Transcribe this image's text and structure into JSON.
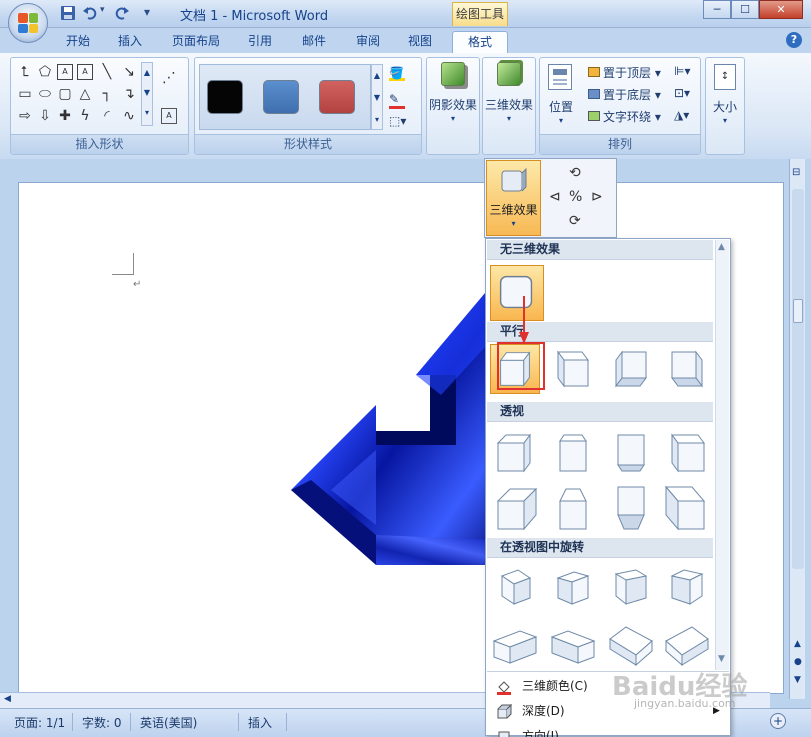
{
  "window": {
    "title": "文档 1 - Microsoft Word",
    "context_tab": "绘图工具",
    "minimize": "─",
    "maximize": "☐",
    "close": "✕"
  },
  "qat": {
    "save_icon": "save-icon",
    "undo_icon": "undo-icon",
    "redo_icon": "redo-icon",
    "customize": "▾"
  },
  "tabs": [
    {
      "label": "开始"
    },
    {
      "label": "插入"
    },
    {
      "label": "页面布局"
    },
    {
      "label": "引用"
    },
    {
      "label": "邮件"
    },
    {
      "label": "审阅"
    },
    {
      "label": "视图"
    },
    {
      "label": "格式",
      "active": true
    }
  ],
  "help": "?",
  "groups": {
    "insert_shapes": "插入形状",
    "shape_styles": "形状样式",
    "shadow_effects": "阴影效果",
    "threed_effects": "三维效果",
    "arrange": "排列",
    "size": "大小"
  },
  "arrange_buttons": {
    "position": "位置",
    "bring_to_front": "置于顶层",
    "send_to_back": "置于底层",
    "text_wrap": "文字环绕"
  },
  "swatches": [
    "#050505",
    "#4f81bd",
    "#c0504d"
  ],
  "dropdown_header": {
    "label": "三维效果"
  },
  "gallery": {
    "sections": [
      {
        "title": "无三维效果"
      },
      {
        "title": "平行"
      },
      {
        "title": "透视"
      },
      {
        "title": "在透视图中旋转"
      }
    ]
  },
  "menu": [
    {
      "label": "三维颜色(C)",
      "icon": "fill-color-icon"
    },
    {
      "label": "深度(D)",
      "icon": "depth-icon"
    },
    {
      "label": "方向(I)",
      "icon": "direction-icon"
    }
  ],
  "status": {
    "page": "页面: 1/1",
    "words": "字数: 0",
    "language": "英语(美国)",
    "mode": "插入"
  },
  "watermark": {
    "brand": "Baidu经验",
    "url": "jingyan.baidu.com"
  }
}
